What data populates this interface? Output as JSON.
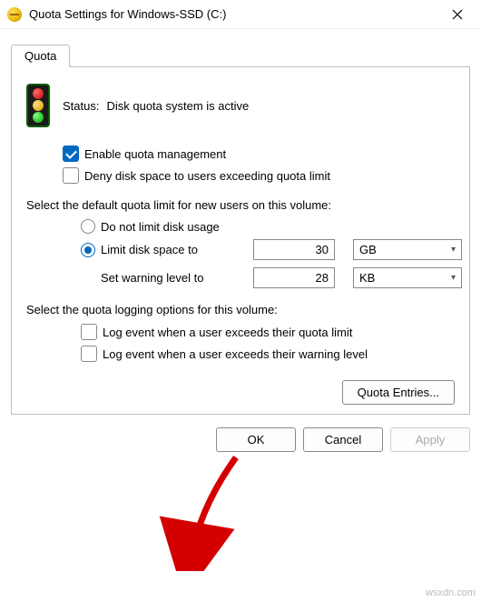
{
  "window": {
    "title": "Quota Settings for Windows-SSD (C:)"
  },
  "tab": {
    "label": "Quota"
  },
  "status": {
    "label": "Status:",
    "value": "Disk quota system is active"
  },
  "options": {
    "enable_label": "Enable quota management",
    "enable_checked": true,
    "deny_label": "Deny disk space to users exceeding quota limit",
    "deny_checked": false
  },
  "limit_section": {
    "heading": "Select the default quota limit for new users on this volume:",
    "no_limit_label": "Do not limit disk usage",
    "no_limit_selected": false,
    "limit_label": "Limit disk space to",
    "limit_selected": true,
    "limit_value": "30",
    "limit_unit": "GB",
    "warning_label": "Set warning level to",
    "warning_value": "28",
    "warning_unit": "KB"
  },
  "logging_section": {
    "heading": "Select the quota logging options for this volume:",
    "log_exceed_limit_label": "Log event when a user exceeds their quota limit",
    "log_exceed_limit_checked": false,
    "log_exceed_warning_label": "Log event when a user exceeds their warning level",
    "log_exceed_warning_checked": false
  },
  "buttons": {
    "entries": "Quota Entries...",
    "ok": "OK",
    "cancel": "Cancel",
    "apply": "Apply"
  },
  "watermark": "wsxdn.com"
}
